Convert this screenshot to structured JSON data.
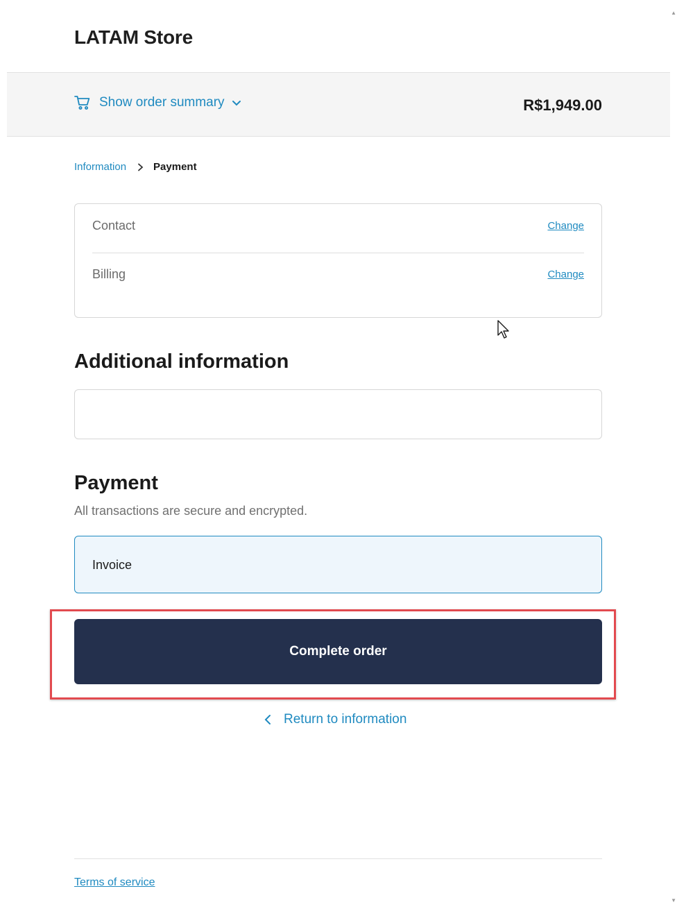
{
  "header": {
    "store_name": "LATAM Store"
  },
  "summary": {
    "toggle_label": "Show order summary",
    "total": "R$1,949.00"
  },
  "breadcrumb": {
    "step1": "Information",
    "step2": "Payment"
  },
  "review": {
    "contact_label": "Contact",
    "billing_label": "Billing",
    "change_label": "Change"
  },
  "additional": {
    "heading": "Additional information",
    "value": "",
    "placeholder": ""
  },
  "payment": {
    "heading": "Payment",
    "subtext": "All transactions are secure and encrypted.",
    "selected_method": "Invoice"
  },
  "actions": {
    "complete_label": "Complete order",
    "return_label": "Return to information"
  },
  "footer": {
    "terms_label": "Terms of service"
  },
  "colors": {
    "accent": "#1f8ac0",
    "button": "#24304d",
    "highlight": "#e24a4f",
    "option_bg": "#eef6fc"
  },
  "icons": [
    "cart-icon",
    "chevron-down-icon",
    "chevron-right-icon",
    "chevron-left-icon",
    "mouse-cursor-icon"
  ]
}
